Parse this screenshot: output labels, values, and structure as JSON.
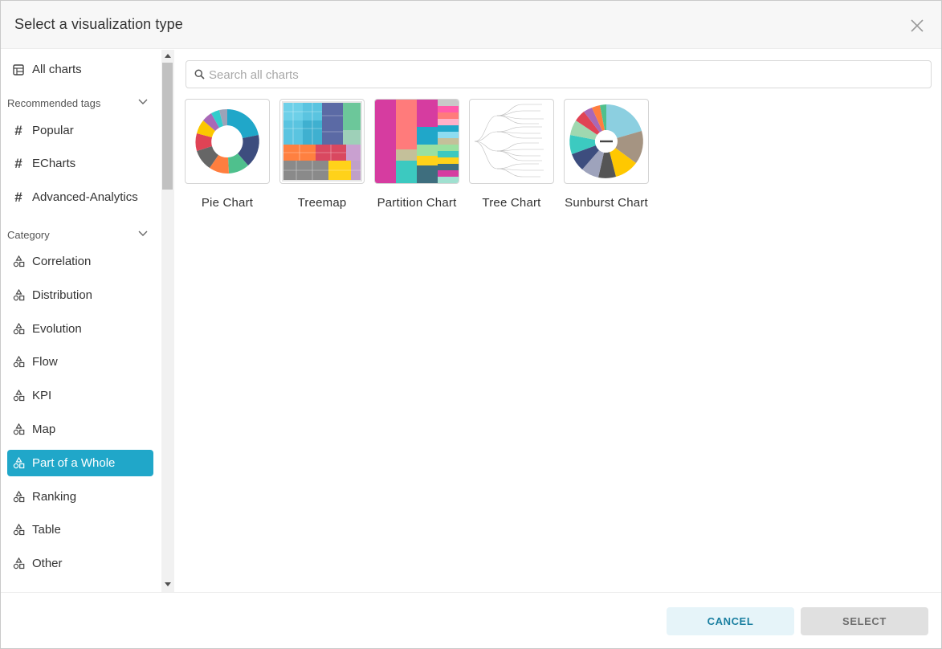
{
  "dialog": {
    "title": "Select a visualization type"
  },
  "sidebar": {
    "all_charts": "All charts",
    "recommended_tags_label": "Recommended tags",
    "tags": [
      "Popular",
      "ECharts",
      "Advanced-Analytics"
    ],
    "category_label": "Category",
    "categories": [
      "Correlation",
      "Distribution",
      "Evolution",
      "Flow",
      "KPI",
      "Map",
      "Part of a Whole",
      "Ranking",
      "Table",
      "Other"
    ],
    "active_category": "Part of a Whole"
  },
  "search": {
    "placeholder": "Search all charts",
    "value": ""
  },
  "charts": [
    {
      "label": "Pie Chart",
      "thumbnail": "pie-chart-thumbnail"
    },
    {
      "label": "Treemap",
      "thumbnail": "treemap-thumbnail"
    },
    {
      "label": "Partition Chart",
      "thumbnail": "partition-chart-thumbnail"
    },
    {
      "label": "Tree Chart",
      "thumbnail": "tree-chart-thumbnail"
    },
    {
      "label": "Sunburst Chart",
      "thumbnail": "sunburst-chart-thumbnail"
    }
  ],
  "footer": {
    "cancel_label": "CANCEL",
    "select_label": "SELECT"
  },
  "colors": {
    "accent": "#20a7c9",
    "cancel_bg": "#e6f4f9",
    "cancel_text": "#1a7fa0",
    "select_bg": "#e0e0e0"
  },
  "icons": {
    "close": "close-icon",
    "all_charts": "table-icon",
    "tag": "hashtag-icon",
    "category": "shapes-icon",
    "search": "search-icon",
    "collapse": "chevron-down-icon"
  }
}
